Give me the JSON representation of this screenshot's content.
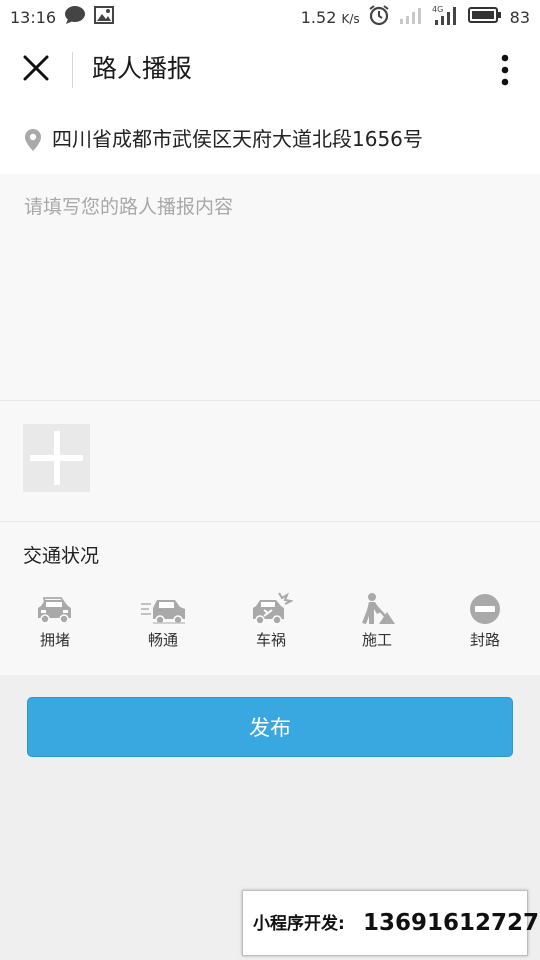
{
  "status_bar": {
    "time": "13:16",
    "speed": "1.52",
    "speed_unit": "K/s",
    "network": "4G",
    "battery": "83",
    "icons": [
      "chat-bubble-icon",
      "image-notification-icon",
      "alarm-icon",
      "signal-empty-icon",
      "signal-4g-icon",
      "battery-icon"
    ]
  },
  "header": {
    "title": "路人播报",
    "icons": [
      "close-icon",
      "more-vertical-icon"
    ]
  },
  "location": {
    "icon": "location-pin-icon",
    "address": "四川省成都市武侯区天府大道北段1656号"
  },
  "content": {
    "placeholder": "请填写您的路人播报内容",
    "value": ""
  },
  "photo": {
    "icon": "plus-icon"
  },
  "traffic": {
    "heading": "交通状况",
    "options": [
      {
        "label": "拥堵",
        "icon": "congested-car-icon"
      },
      {
        "label": "畅通",
        "icon": "moving-car-icon"
      },
      {
        "label": "车祸",
        "icon": "car-accident-icon"
      },
      {
        "label": "施工",
        "icon": "construction-worker-icon"
      },
      {
        "label": "封路",
        "icon": "road-closed-icon"
      }
    ]
  },
  "publish": {
    "label": "发布"
  },
  "promo": {
    "label": "小程序开发:",
    "phone": "13691612727"
  },
  "colors": {
    "accent": "#3aa8e0",
    "background": "#efefef",
    "panel": "#f8f8f8",
    "icon_gray": "#a9a9a9"
  }
}
